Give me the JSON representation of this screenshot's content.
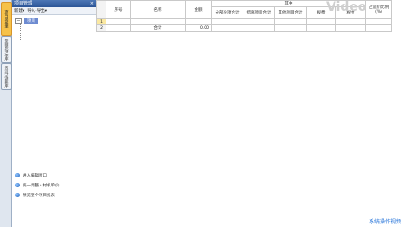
{
  "sidebar_tabs": [
    "项目管理",
    "定额指标库",
    "资料档案库"
  ],
  "panel": {
    "title": "项目管理",
    "close": "×",
    "toolbar": {
      "new_label": "新建▾",
      "import_label": "导入·导出▾"
    },
    "tree_node": "项目",
    "actions": [
      {
        "label": "进入编辑窗口"
      },
      {
        "label": "统一调整人材机单价"
      },
      {
        "label": "预览整个项目报表"
      }
    ]
  },
  "table": {
    "top_headers": {
      "group": "其中",
      "note": "占造价比例(%)"
    },
    "headers": [
      "序号",
      "名称",
      "金额",
      "分部分项合计",
      "措施项目合计",
      "其他项目合计",
      "规费",
      "税金"
    ],
    "rows": [
      {
        "row_no": "1",
        "seq": "",
        "name": "",
        "amount": ""
      },
      {
        "row_no": "2",
        "seq": "",
        "name": "合计",
        "amount": "0.00"
      }
    ]
  },
  "watermark": "Video",
  "brand": "系统操作视频"
}
